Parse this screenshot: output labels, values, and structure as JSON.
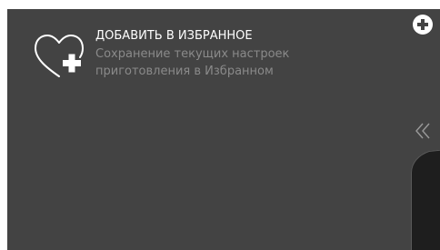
{
  "favorites": {
    "title": "ДОБАВИТЬ В ИЗБРАННОЕ",
    "description_line1": "Сохранение текущих настроек",
    "description_line2": "приготовления в Избранном",
    "icon": "heart-plus-icon"
  },
  "header": {
    "add_icon": "plus-circle-icon"
  },
  "side": {
    "collapse_icon": "double-chevron-left-icon"
  },
  "colors": {
    "panel_bg": "#434343",
    "title": "#ffffff",
    "description": "#8a8a8a",
    "side_panel": "#1e1e1e"
  }
}
